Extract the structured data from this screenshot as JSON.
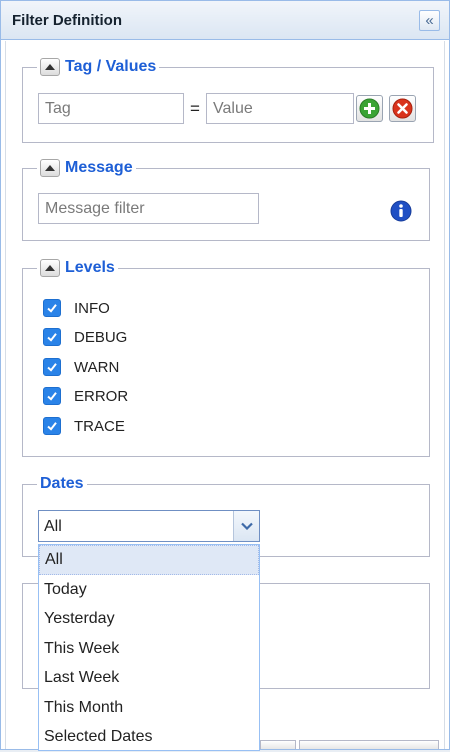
{
  "panel": {
    "title": "Filter Definition",
    "collapse_icon": "double-chevron-left-icon"
  },
  "tag_values": {
    "legend": "Tag / Values",
    "tag_placeholder": "Tag",
    "equals": "=",
    "value_placeholder": "Value",
    "add_icon": "plus-icon",
    "remove_icon": "close-icon",
    "colors": {
      "add": "#3aa335",
      "remove": "#d9331c"
    }
  },
  "message": {
    "legend": "Message",
    "placeholder": "Message filter",
    "info_icon": "info-icon",
    "info_color": "#1f4fc4"
  },
  "levels": {
    "legend": "Levels",
    "items": [
      {
        "label": "INFO",
        "checked": true
      },
      {
        "label": "DEBUG",
        "checked": true
      },
      {
        "label": "WARN",
        "checked": true
      },
      {
        "label": "ERROR",
        "checked": true
      },
      {
        "label": "TRACE",
        "checked": true
      }
    ]
  },
  "dates": {
    "legend": "Dates",
    "selected": "All",
    "options": [
      "All",
      "Today",
      "Yesterday",
      "This Week",
      "Last Week",
      "This Month",
      "Selected Dates"
    ]
  },
  "colors": {
    "accent": "#1e5fd6",
    "border": "#99bbe8",
    "checkbox": "#2a83e8"
  }
}
